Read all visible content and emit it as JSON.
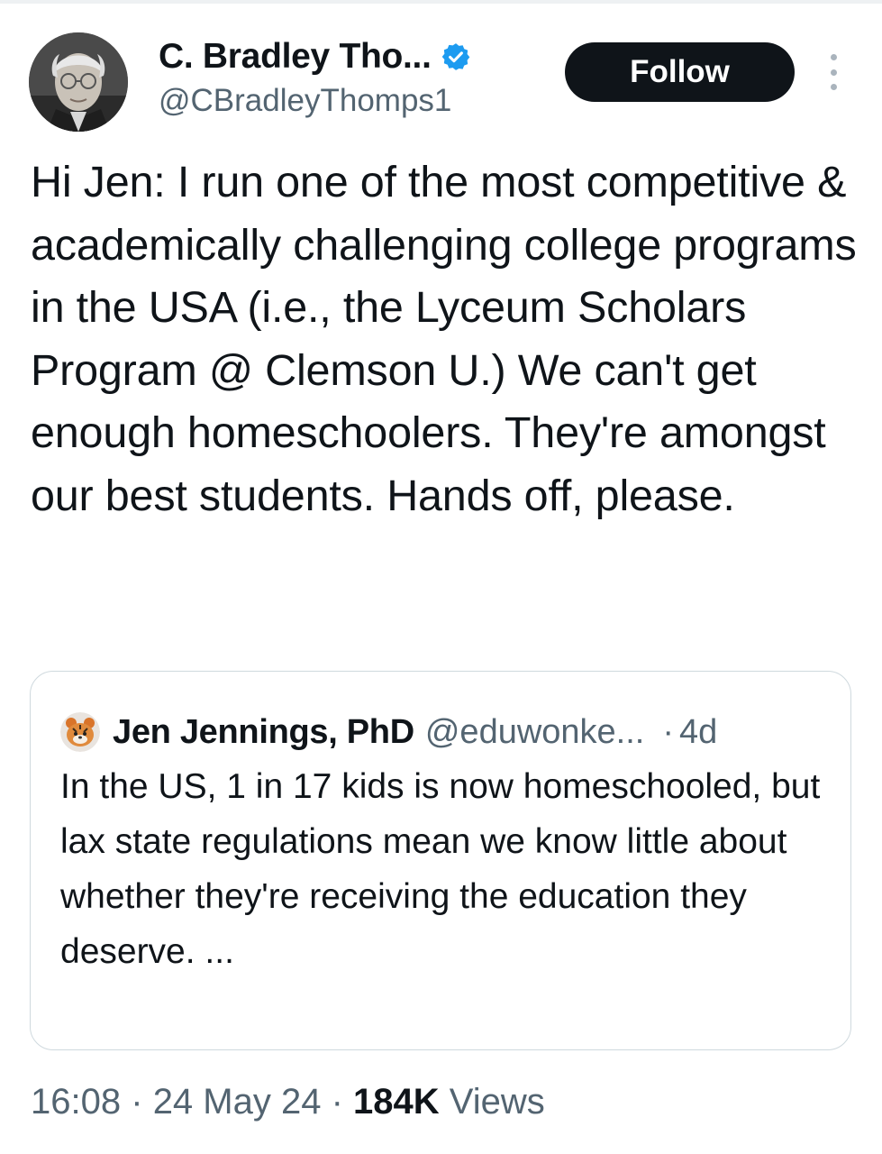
{
  "author": {
    "display_name": "C. Bradley Tho...",
    "handle": "@CBradleyThomps1",
    "verified": true
  },
  "actions": {
    "follow_label": "Follow"
  },
  "tweet": {
    "text": "Hi Jen: I run one of the most competitive & academically challenging college programs in the USA (i.e., the Lyceum Scholars Program @ Clemson U.) We can't get enough homeschoolers. They're amongst our best students. Hands off, please."
  },
  "quoted_tweet": {
    "display_name": "Jen Jennings, PhD",
    "handle": "@eduwonke...",
    "separator": "·",
    "time": "4d",
    "text": "In the US, 1 in 17 kids is now homeschooled, but lax state regulations mean we know little about whether they're receiving the education they deserve. ..."
  },
  "meta": {
    "time": "16:08",
    "sep1": "·",
    "date": "24 May 24",
    "sep2": "·",
    "views_count": "184K",
    "views_label": "Views"
  },
  "colors": {
    "text_primary": "#0f1419",
    "text_secondary": "#536471",
    "verified_blue": "#1d9bf0",
    "border": "#cfd9de"
  },
  "icons": {
    "verified": "verified-badge-icon",
    "more": "more-vertical-icon"
  }
}
